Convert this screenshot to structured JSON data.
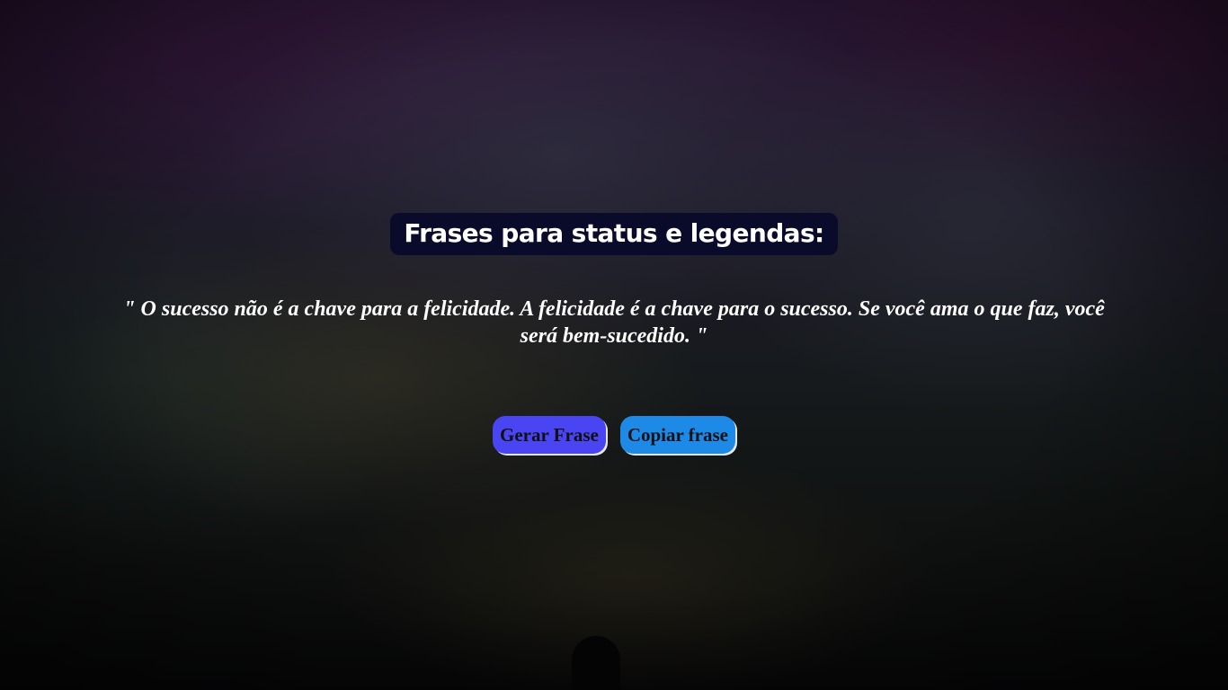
{
  "page": {
    "title": "Frases para status e legendas:",
    "quote": "\" O sucesso não é a chave para a felicidade. A felicidade é a chave para o sucesso. Se você ama o que faz, você será bem-sucedido. \""
  },
  "buttons": {
    "generate_label": "Gerar Frase",
    "copy_label": "Copiar frase"
  },
  "colors": {
    "title_background": "#0a0a2a",
    "generate_button": "#4a45f2",
    "copy_button": "#1e8ae8",
    "text": "#ffffff"
  }
}
